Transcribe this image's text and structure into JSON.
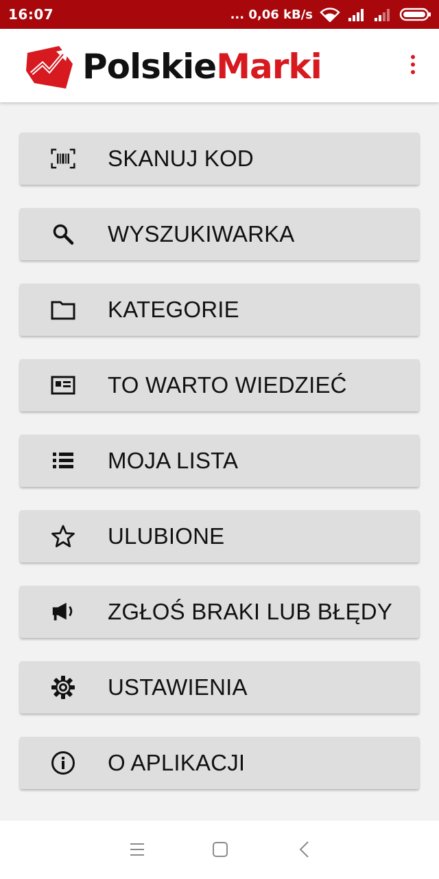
{
  "status_bar": {
    "time": "16:07",
    "network_speed": "... 0,06 kB/s",
    "icons": [
      "wifi-icon",
      "signal-icon",
      "signal-weak-icon",
      "battery-icon"
    ]
  },
  "header": {
    "logo_part1": "Polskie",
    "logo_part2": "Marki",
    "brand_color": "#d71920",
    "menu_icon": "more-vert-icon"
  },
  "menu": {
    "items": [
      {
        "label": "SKANUJ KOD",
        "icon": "barcode-scan-icon"
      },
      {
        "label": "WYSZUKIWARKA",
        "icon": "search-icon"
      },
      {
        "label": "KATEGORIE",
        "icon": "folder-icon"
      },
      {
        "label": "TO WARTO WIEDZIEĆ",
        "icon": "article-icon"
      },
      {
        "label": "MOJA LISTA",
        "icon": "list-icon"
      },
      {
        "label": "ULUBIONE",
        "icon": "star-icon"
      },
      {
        "label": "ZGŁOŚ BRAKI LUB BŁĘDY",
        "icon": "megaphone-icon"
      },
      {
        "label": "USTAWIENIA",
        "icon": "gear-icon"
      },
      {
        "label": "O APLIKACJI",
        "icon": "info-icon"
      }
    ]
  },
  "nav_bar": {
    "buttons": [
      "menu-icon",
      "home-square-icon",
      "back-icon"
    ]
  },
  "colors": {
    "status_bar": "#a8070c",
    "accent": "#d71920",
    "button_bg": "#dedede",
    "page_bg": "#f2f2f2"
  }
}
